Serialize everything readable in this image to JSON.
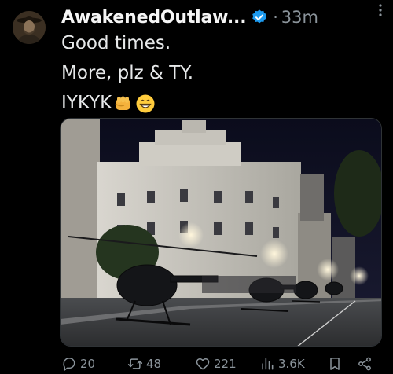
{
  "post": {
    "author_name": "AwakenedOutlaw...",
    "separator": "·",
    "timestamp": "33m",
    "more_icon": "more-vertical-icon",
    "text_lines": [
      "Good times.",
      "More, plz & TY.",
      "IYKYK"
    ],
    "emojis": [
      "oncoming-fist-emoji",
      "grinning-face-emoji"
    ],
    "verified_color": "#1d9bf0"
  },
  "actions": {
    "replies": "20",
    "reposts": "48",
    "likes": "221",
    "views": "3.6K"
  }
}
